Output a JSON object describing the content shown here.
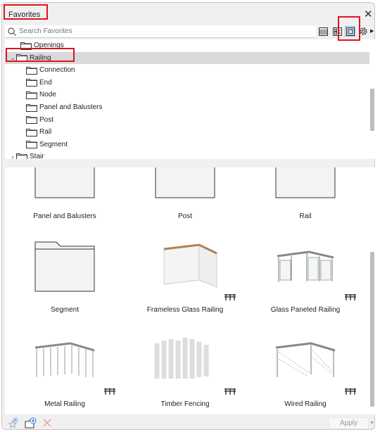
{
  "title": "Favorites",
  "search": {
    "placeholder": "Search Favorites"
  },
  "view_modes": [
    {
      "icon": "list-view-icon"
    },
    {
      "icon": "small-grid-view-icon"
    },
    {
      "icon": "large-thumbnail-view-icon",
      "selected": true
    },
    {
      "icon": "gear-icon"
    }
  ],
  "tree": {
    "items": [
      {
        "label": "Openings",
        "level": 1,
        "expanded": null
      },
      {
        "label": "Railing",
        "level": 0,
        "expanded": true,
        "selected": true
      },
      {
        "label": "Connection",
        "level": 2
      },
      {
        "label": "End",
        "level": 2
      },
      {
        "label": "Node",
        "level": 2
      },
      {
        "label": "Panel and Balusters",
        "level": 2
      },
      {
        "label": "Post",
        "level": 2
      },
      {
        "label": "Rail",
        "level": 2
      },
      {
        "label": "Segment",
        "level": 2
      },
      {
        "label": "Stair",
        "level": 0,
        "expanded": false
      }
    ]
  },
  "grid": {
    "items": [
      {
        "label": "Panel and Balusters",
        "kind": "folder"
      },
      {
        "label": "Post",
        "kind": "folder"
      },
      {
        "label": "Rail",
        "kind": "folder"
      },
      {
        "label": "Segment",
        "kind": "folder"
      },
      {
        "label": "Frameless Glass Railing",
        "kind": "railing"
      },
      {
        "label": "Glass Paneled Railing",
        "kind": "railing"
      },
      {
        "label": "Metal Railing",
        "kind": "railing"
      },
      {
        "label": "Timber Fencing",
        "kind": "railing"
      },
      {
        "label": "Wired Railing",
        "kind": "railing"
      }
    ]
  },
  "footer": {
    "apply_label": "Apply"
  },
  "colors": {
    "highlight": "#e0141c",
    "selected_row": "#d9d9d9",
    "selected_view": "#cde4f7"
  }
}
